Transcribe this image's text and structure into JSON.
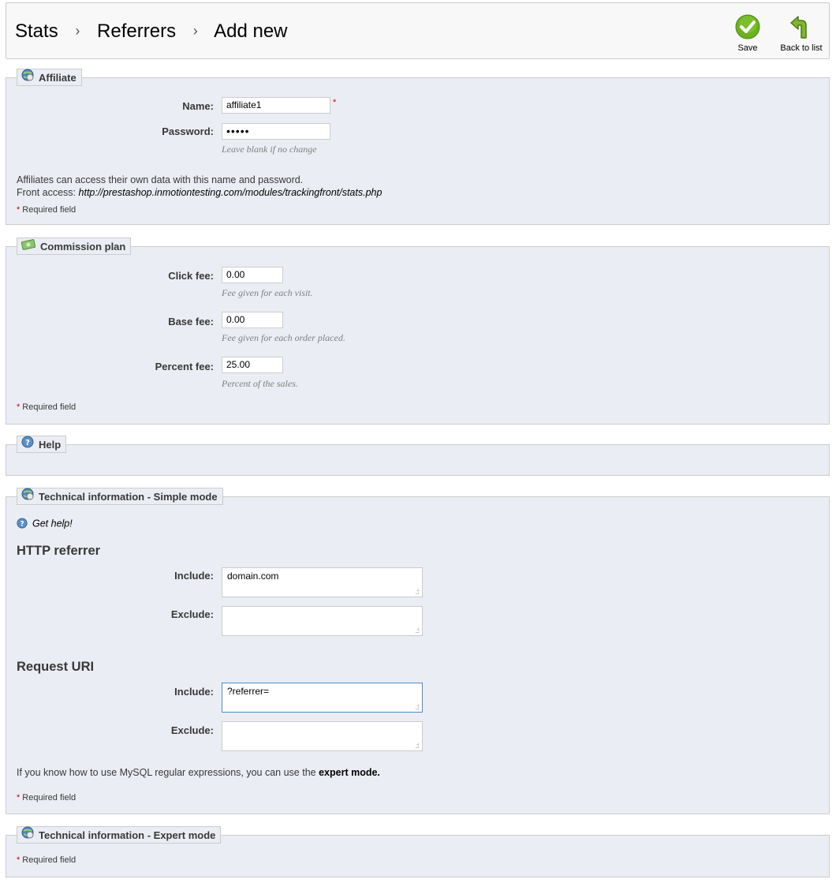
{
  "breadcrumb": {
    "items": [
      "Stats",
      "Referrers",
      "Add new"
    ],
    "separator": "›"
  },
  "toolbar": {
    "save_label": "Save",
    "back_label": "Back to list"
  },
  "affiliate": {
    "legend": "Affiliate",
    "name_label": "Name:",
    "name_value": "affiliate1",
    "password_label": "Password:",
    "password_value": "•••••",
    "password_hint": "Leave blank if no change",
    "info_line1": "Affiliates can access their own data with this name and password.",
    "front_access_label": "Front access:",
    "front_access_url": "http://prestashop.inmotiontesting.com/modules/trackingfront/stats.php",
    "required": "Required field"
  },
  "commission": {
    "legend": "Commission plan",
    "click_label": "Click fee:",
    "click_value": "0.00",
    "click_hint": "Fee given for each visit.",
    "base_label": "Base fee:",
    "base_value": "0.00",
    "base_hint": "Fee given for each order placed.",
    "percent_label": "Percent fee:",
    "percent_value": "25.00",
    "percent_hint": "Percent of the sales.",
    "required": "Required field"
  },
  "help": {
    "legend": "Help"
  },
  "simple": {
    "legend": "Technical information - Simple mode",
    "get_help": "Get help!",
    "http_heading": "HTTP referrer",
    "http_include_label": "Include:",
    "http_include_value": "domain.com",
    "http_exclude_label": "Exclude:",
    "http_exclude_value": "",
    "request_heading": "Request URI",
    "req_include_label": "Include:",
    "req_include_value": "?referrer=",
    "req_exclude_label": "Exclude:",
    "req_exclude_value": "",
    "expert_text": "If you know how to use MySQL regular expressions, you can use the",
    "expert_link": "expert mode.",
    "required": "Required field"
  },
  "expert": {
    "legend": "Technical information - Expert mode",
    "required": "Required field"
  },
  "required_star": "*",
  "colors": {
    "panel_bg": "#ebedf4",
    "border": "#cccccc",
    "required": "#cc0000",
    "save_green": "#6bb120",
    "focus": "#4a8cc7"
  }
}
